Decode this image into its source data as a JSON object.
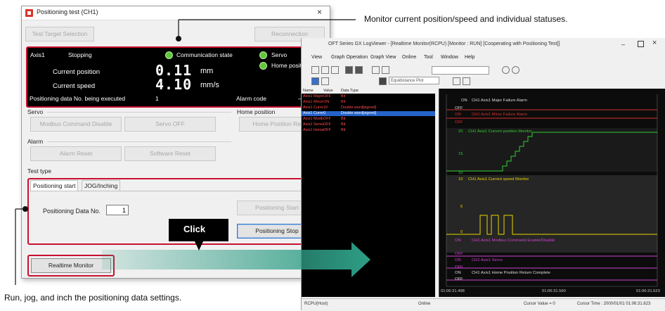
{
  "dialog": {
    "title": "Positioning test (CH1)",
    "close_glyph": "×",
    "test_target_label": "Test Target Selection",
    "reconnection_label": "Reconnection",
    "status": {
      "axis": "Axis1",
      "state": "Stopping",
      "communication_label": "Communication state",
      "servo_label": "Servo",
      "home_label": "Home position",
      "current_position_label": "Current position",
      "current_position_value": "0.11",
      "current_position_unit": "mm",
      "current_speed_label": "Current speed",
      "current_speed_value": "4.10",
      "current_speed_unit": "mm/s",
      "positioning_data_label": "Positioning data No. being executed",
      "positioning_data_value": "1",
      "alarm_code_label": "Alarm code",
      "alarm_code_value": "—"
    },
    "servo_group": "Servo",
    "modbus_button": "Modbus Command Disable",
    "servo_off_button": "Servo OFF",
    "home_group": "Home position",
    "home_return_button": "Home Position Return",
    "alarm_group": "Alarm",
    "alarm_reset_button": "Alarm Reset",
    "software_reset_button": "Software Reset",
    "test_type_group": "Test type",
    "tabs": [
      "Positioning start",
      "JOG/Inching"
    ],
    "positioning_data_no_label": "Positioning Data No.",
    "positioning_data_no_value": "1",
    "positioning_start_button": "Positioning Start",
    "positioning_stop_button": "Positioning Stop",
    "realtime_monitor_button": "Realtime Monitor"
  },
  "logviewer": {
    "title": "OFT Series GX LogViewer - [Realtime Monitor(RCPU) [Monitor : RUN] [Cooperating with Positioning Test]]",
    "menu": [
      "View",
      "Graph Operation",
      "Graph View",
      "Online",
      "Tool",
      "Window",
      "Help"
    ],
    "toolbar_text": "Equidistance Plot",
    "list_headers": [
      "Name",
      "Value",
      "Data Type"
    ],
    "list_rows": [
      {
        "name": "Axis1 Major",
        "value": "OFF",
        "type": "Bit"
      },
      {
        "name": "Axis1 Minor",
        "value": "ON",
        "type": "Bit"
      },
      {
        "name": "Axis1 Curre",
        "value": "10",
        "type": "Double word[signed]"
      },
      {
        "name": "Axis1 Curre",
        "value": "0",
        "type": "Double word[signed]"
      },
      {
        "name": "Axis1 Modb",
        "value": "OFF",
        "type": "Bit"
      },
      {
        "name": "Axis1 Servo",
        "value": "OFF",
        "type": "Bit"
      },
      {
        "name": "Axis1 Home",
        "value": "OFF",
        "type": "Bit"
      }
    ],
    "graph_labels": {
      "major_fail": "CH1 Axis1 Major Failure Alarm",
      "minor_fail": "CH1 Axis1 Minor Failure Alarm",
      "position_monitor": "CH1 Axis1 Current position Monitor",
      "speed_monitor": "CH1 Axis1 Current speed Monitor",
      "modbus": "CH1 Axis1 Modbus Command Enable/Disable",
      "servo": "CH1 Axis1 Servo",
      "home_return": "CH1 Axis1 Home Position Return Complete",
      "on": "ON",
      "off": "OFF",
      "y20": "20",
      "y15": "15",
      "y10": "10",
      "y10b": "10",
      "y5": "5",
      "y0": "0"
    },
    "time_ticks": [
      "01:06:31.498",
      "01:06:31.560",
      "01:06:31.623"
    ],
    "status_left": "RCPU(Host)",
    "status_online": "Online",
    "cursor_value": "Cursor Value = 0",
    "cursor_time": "Cursor Time : 2000/01/01 01:06:31.623"
  },
  "annotations": {
    "monitor_note": "Monitor current position/speed and individual statuses.",
    "run_note": "Run, jog, and inch the positioning data settings.",
    "click_label": "Click"
  },
  "colors": {
    "highlight": "#c8102e",
    "led": "#5ec73a",
    "arrow": "#2f9e86",
    "graph_red": "#d43030",
    "graph_green": "#33cc33",
    "graph_yellow": "#e8d400",
    "graph_magenta": "#d040d0"
  }
}
